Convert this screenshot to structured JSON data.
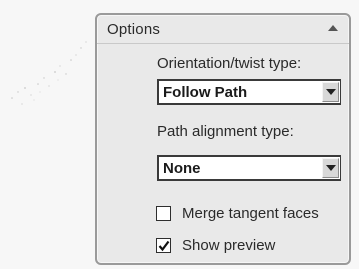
{
  "options_panel": {
    "title": "Options",
    "collapse_icon": "chevron-up-icon",
    "orientation": {
      "label": "Orientation/twist type:",
      "selected": "Follow Path"
    },
    "path_alignment": {
      "label": "Path alignment type:",
      "selected": "None"
    },
    "merge_tangent_faces": {
      "label": "Merge tangent faces",
      "checked": false
    },
    "show_preview": {
      "label": "Show preview",
      "checked": true
    }
  }
}
